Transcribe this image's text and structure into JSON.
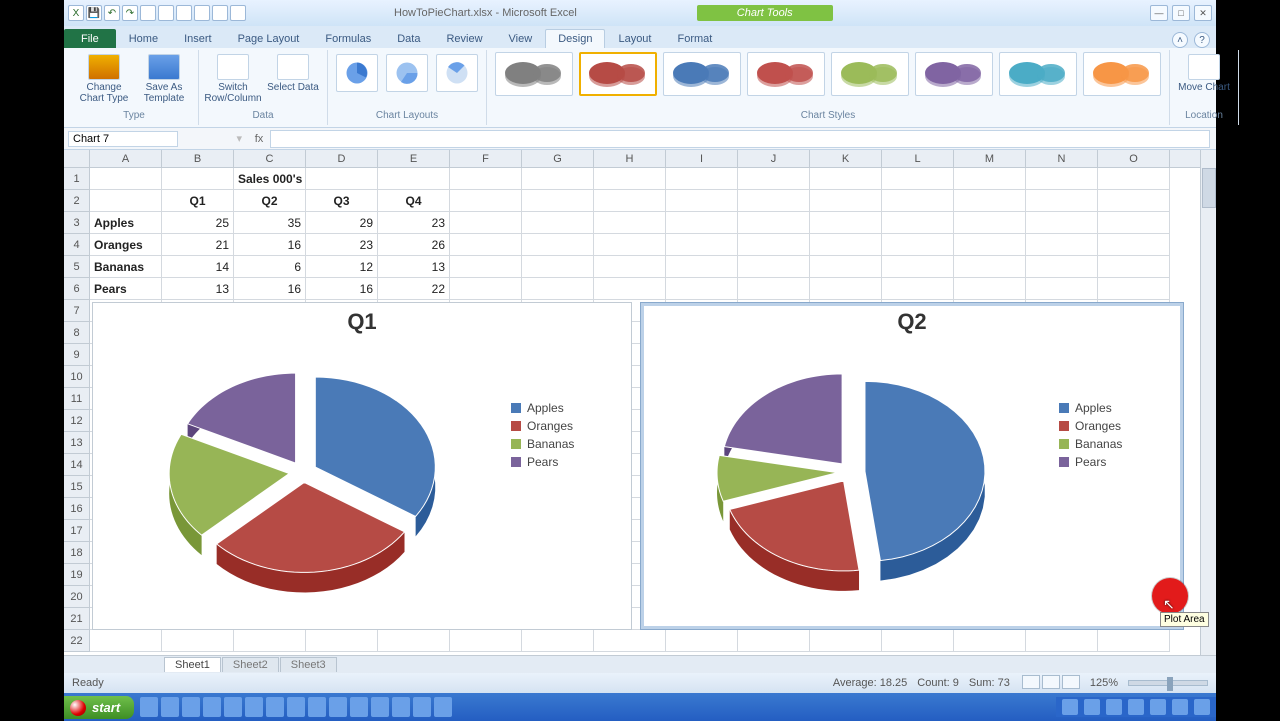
{
  "titlebar": {
    "doc": "HowToPieChart.xlsx - Microsoft Excel",
    "contextual": "Chart Tools"
  },
  "tabs": {
    "file": "File",
    "home": "Home",
    "insert": "Insert",
    "pagelayout": "Page Layout",
    "formulas": "Formulas",
    "data": "Data",
    "review": "Review",
    "view": "View",
    "design": "Design",
    "layout": "Layout",
    "format": "Format"
  },
  "ribbon": {
    "type_group": "Type",
    "change_type": "Change Chart Type",
    "save_template": "Save As Template",
    "data_group": "Data",
    "switch": "Switch Row/Column",
    "select": "Select Data",
    "layouts_group": "Chart Layouts",
    "styles_group": "Chart Styles",
    "location_group": "Location",
    "move": "Move Chart"
  },
  "namebox": "Chart 7",
  "fx": "fx",
  "columns": [
    "A",
    "B",
    "C",
    "D",
    "E",
    "F",
    "G",
    "H",
    "I",
    "J",
    "K",
    "L",
    "M",
    "N",
    "O"
  ],
  "data_rows": {
    "title": "Sales 000's",
    "headers": [
      "Q1",
      "Q2",
      "Q3",
      "Q4"
    ],
    "cats": [
      "Apples",
      "Oranges",
      "Bananas",
      "Pears"
    ],
    "vals": [
      [
        25,
        35,
        29,
        23
      ],
      [
        21,
        16,
        23,
        26
      ],
      [
        14,
        6,
        12,
        13
      ],
      [
        13,
        16,
        16,
        22
      ]
    ]
  },
  "chart_data": [
    {
      "type": "pie",
      "title": "Q1",
      "categories": [
        "Apples",
        "Oranges",
        "Bananas",
        "Pears"
      ],
      "values": [
        25,
        21,
        14,
        13
      ],
      "colors": [
        "#4a7ab7",
        "#b64b45",
        "#97b556",
        "#7a639b"
      ]
    },
    {
      "type": "pie",
      "title": "Q2",
      "categories": [
        "Apples",
        "Oranges",
        "Bananas",
        "Pears"
      ],
      "values": [
        35,
        16,
        6,
        16
      ],
      "colors": [
        "#4a7ab7",
        "#b64b45",
        "#97b556",
        "#7a639b"
      ]
    }
  ],
  "legend": [
    "Apples",
    "Oranges",
    "Bananas",
    "Pears"
  ],
  "legend_colors": [
    "#4a7ab7",
    "#b64b45",
    "#97b556",
    "#7a639b"
  ],
  "sheets": [
    "Sheet1",
    "Sheet2",
    "Sheet3"
  ],
  "status": {
    "ready": "Ready",
    "avg": "Average: 18.25",
    "count": "Count: 9",
    "sum": "Sum: 73",
    "zoom": "125%"
  },
  "start": "start",
  "tooltip": "Plot Area"
}
